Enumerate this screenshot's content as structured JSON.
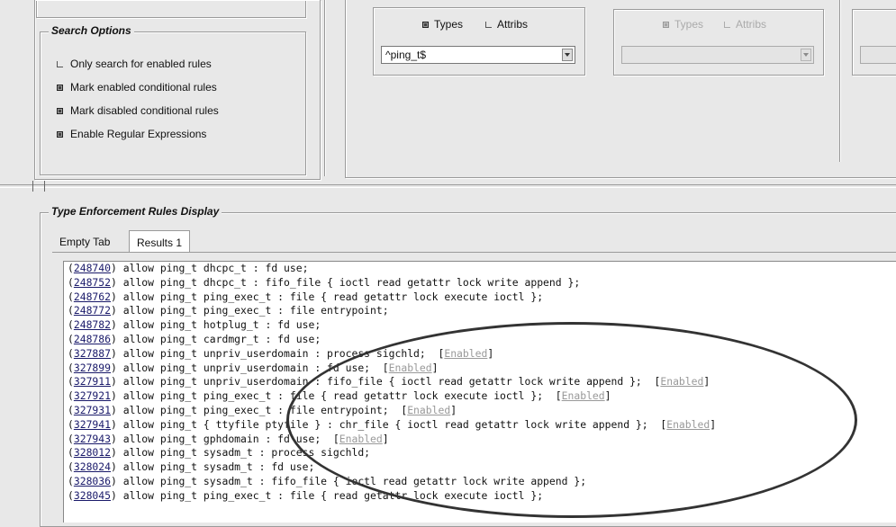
{
  "search_options": {
    "legend": "Search Options",
    "options": [
      {
        "label": "Only search for enabled rules",
        "checked": false
      },
      {
        "label": "Mark enabled conditional rules",
        "checked": true
      },
      {
        "label": "Mark disabled conditional rules",
        "checked": true
      },
      {
        "label": "Enable Regular Expressions",
        "checked": true
      }
    ]
  },
  "source_panel": {
    "types_label": "Types",
    "attribs_label": "Attribs",
    "types_checked": true,
    "attribs_checked": false,
    "value": "^ping_t$"
  },
  "target_panel": {
    "types_label": "Types",
    "attribs_label": "Attribs",
    "value": ""
  },
  "display": {
    "legend": "Type Enforcement Rules Display",
    "tabs": [
      "Empty Tab",
      "Results 1"
    ],
    "active_tab": 1
  },
  "rules": [
    {
      "id": "248740",
      "text": " allow ping_t dhcpc_t : fd use;",
      "status": ""
    },
    {
      "id": "248752",
      "text": " allow ping_t dhcpc_t : fifo_file { ioctl read getattr lock write append };",
      "status": ""
    },
    {
      "id": "248762",
      "text": " allow ping_t ping_exec_t : file { read getattr lock execute ioctl };",
      "status": ""
    },
    {
      "id": "248772",
      "text": " allow ping_t ping_exec_t : file entrypoint;",
      "status": ""
    },
    {
      "id": "248782",
      "text": " allow ping_t hotplug_t : fd use;",
      "status": ""
    },
    {
      "id": "248786",
      "text": " allow ping_t cardmgr_t : fd use;",
      "status": ""
    },
    {
      "id": "327887",
      "text": " allow ping_t unpriv_userdomain : process sigchld;  ",
      "status": "Enabled"
    },
    {
      "id": "327899",
      "text": " allow ping_t unpriv_userdomain : fd use;  ",
      "status": "Enabled"
    },
    {
      "id": "327911",
      "text": " allow ping_t unpriv_userdomain : fifo_file { ioctl read getattr lock write append };  ",
      "status": "Enabled"
    },
    {
      "id": "327921",
      "text": " allow ping_t ping_exec_t : file { read getattr lock execute ioctl };  ",
      "status": "Enabled"
    },
    {
      "id": "327931",
      "text": " allow ping_t ping_exec_t : file entrypoint;  ",
      "status": "Enabled"
    },
    {
      "id": "327941",
      "text": " allow ping_t { ttyfile ptyfile } : chr_file { ioctl read getattr lock write append };  ",
      "status": "Enabled"
    },
    {
      "id": "327943",
      "text": " allow ping_t gphdomain : fd use;  ",
      "status": "Enabled"
    },
    {
      "id": "328012",
      "text": " allow ping_t sysadm_t : process sigchld;",
      "status": ""
    },
    {
      "id": "328024",
      "text": " allow ping_t sysadm_t : fd use;",
      "status": ""
    },
    {
      "id": "328036",
      "text": " allow ping_t sysadm_t : fifo_file { ioctl read getattr lock write append };",
      "status": ""
    },
    {
      "id": "328045",
      "text": " allow ping_t ping_exec_t : file { read getattr lock execute ioctl };",
      "status": ""
    }
  ]
}
